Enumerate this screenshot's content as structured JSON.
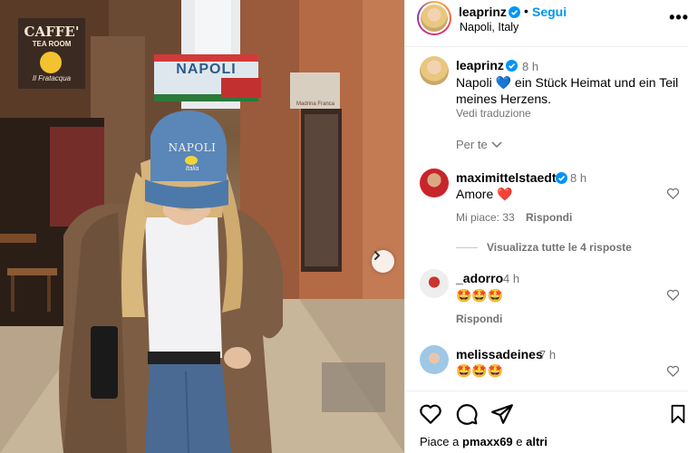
{
  "post": {
    "author": "leaprinz",
    "follow_label": "Segui",
    "location": "Napoli, Italy",
    "separator": "•"
  },
  "caption": {
    "username": "leaprinz",
    "time": "8 h",
    "text_start": "Napoli",
    "text_emoji": "💙",
    "text_line1_rest": "ein Stück Heimat und ein Teil",
    "text_line2": "meines Herzens.",
    "translate": "Vedi traduzione"
  },
  "per_te": "Per te",
  "comments": [
    {
      "username": "maximittelstaedt",
      "verified": true,
      "time": "8 h",
      "text": "Amore ❤️",
      "likes": "Mi piace: 33",
      "reply": "Rispondi",
      "view_replies": "Visualizza tutte le 4 risposte"
    },
    {
      "username": "_adorro",
      "verified": false,
      "time": "4 h",
      "text": "🤩🤩🤩",
      "reply": "Rispondi"
    },
    {
      "username": "melissadeines",
      "verified": false,
      "time": "7 h",
      "text": "🤩🤩🤩"
    }
  ],
  "footer": {
    "likes_prefix": "Piace a",
    "likes_user": "pmaxx69",
    "likes_conj": "e",
    "likes_others": "altri"
  },
  "photo_signs": {
    "caffe": "CAFFE'",
    "tea_room": "TEA ROOM",
    "shop": "Il Fratacqua",
    "banner": "NAPOLI",
    "cap_text": "NAPOLI",
    "cap_sub": "Italia",
    "shop_right": "Madrina Franca"
  },
  "colors": {
    "accent": "#0095f6",
    "verified": "#0095f6",
    "muted": "#737373",
    "heart_red": "#e0245e",
    "emoji_blue": "#1877f2"
  }
}
